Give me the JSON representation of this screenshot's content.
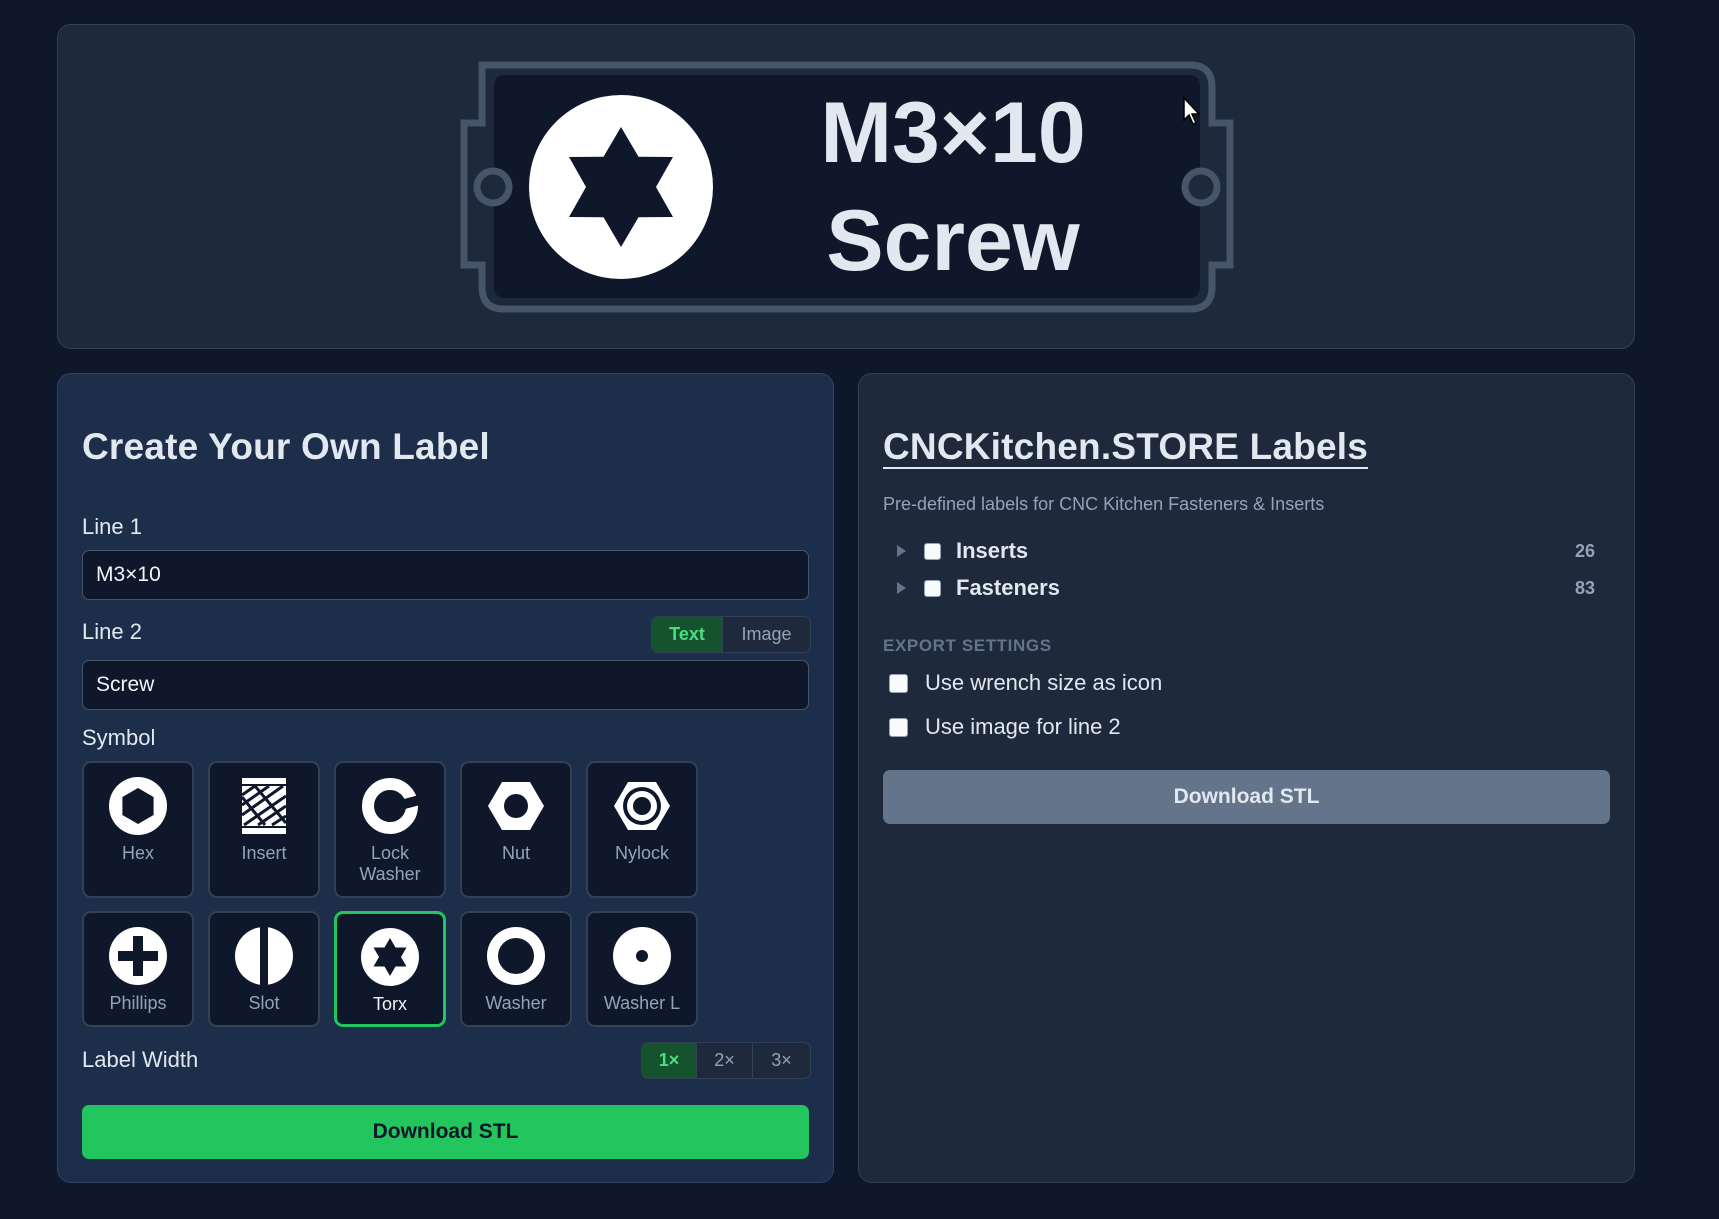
{
  "preview": {
    "line1": "M3×10",
    "line2": "Screw",
    "symbol_icon": "torx-icon"
  },
  "create": {
    "title": "Create Your Own Label",
    "line1_label": "Line 1",
    "line1_value": "M3×10",
    "line2_label": "Line 2",
    "line2_value": "Screw",
    "line2_modes": [
      "Text",
      "Image"
    ],
    "line2_mode_selected": "Text",
    "symbol_label": "Symbol",
    "symbols": [
      {
        "label": "Hex",
        "icon": "hex-icon"
      },
      {
        "label": "Insert",
        "icon": "insert-icon"
      },
      {
        "label": "Lock Washer",
        "icon": "lock-washer-icon"
      },
      {
        "label": "Nut",
        "icon": "nut-icon"
      },
      {
        "label": "Nylock",
        "icon": "nylock-icon"
      },
      {
        "label": "Phillips",
        "icon": "phillips-icon"
      },
      {
        "label": "Slot",
        "icon": "slot-icon"
      },
      {
        "label": "Torx",
        "icon": "torx-icon"
      },
      {
        "label": "Washer",
        "icon": "washer-icon"
      },
      {
        "label": "Washer L",
        "icon": "washer-l-icon"
      }
    ],
    "symbol_selected": "Torx",
    "width_label": "Label Width",
    "width_options": [
      "1×",
      "2×",
      "3×"
    ],
    "width_selected": "1×",
    "download_label": "Download STL"
  },
  "store": {
    "title": "CNCKitchen.STORE Labels",
    "subtitle": "Pre-defined labels for CNC Kitchen Fasteners & Inserts",
    "categories": [
      {
        "label": "Inserts",
        "count": "26"
      },
      {
        "label": "Fasteners",
        "count": "83"
      }
    ],
    "export_heading": "EXPORT SETTINGS",
    "options": [
      {
        "label": "Use wrench size as icon",
        "checked": false
      },
      {
        "label": "Use image for line 2",
        "checked": false
      }
    ],
    "download_label": "Download STL"
  },
  "colors": {
    "page_bg": "#0f172a",
    "panel_bg": "#1e293b",
    "accent_green": "#22c55e",
    "label_text": "#e2e8f0"
  }
}
